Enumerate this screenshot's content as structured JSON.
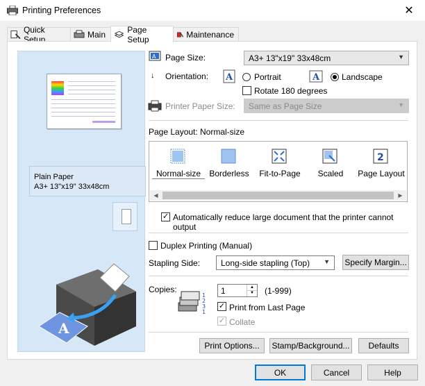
{
  "window": {
    "title": "Printing Preferences",
    "close_glyph": "✕"
  },
  "tabs": [
    {
      "label": "Quick Setup",
      "icon": "quick-setup-icon"
    },
    {
      "label": "Main",
      "icon": "main-icon"
    },
    {
      "label": "Page Setup",
      "icon": "page-setup-icon"
    },
    {
      "label": "Maintenance",
      "icon": "maintenance-icon"
    }
  ],
  "preview": {
    "media_type": "Plain Paper",
    "media_size": "A3+ 13\"x19\" 33x48cm"
  },
  "page_size": {
    "label": "Page Size:",
    "value": "A3+ 13\"x19\" 33x48cm"
  },
  "orientation": {
    "label": "Orientation:",
    "portrait": "Portrait",
    "landscape": "Landscape",
    "selected": "Landscape",
    "rotate_label": "Rotate 180 degrees",
    "rotate_checked": false
  },
  "printer_paper_size": {
    "label": "Printer Paper Size:",
    "value": "Same as Page Size"
  },
  "page_layout": {
    "label": "Page Layout:",
    "current": "Normal-size",
    "options": [
      "Normal-size",
      "Borderless",
      "Fit-to-Page",
      "Scaled",
      "Page Layout"
    ]
  },
  "auto_reduce": {
    "label": "Automatically reduce large document that the printer cannot output",
    "checked": true
  },
  "duplex": {
    "label": "Duplex Printing (Manual)",
    "checked": false
  },
  "stapling": {
    "label": "Stapling Side:",
    "value": "Long-side stapling (Top)",
    "specify_margin": "Specify Margin..."
  },
  "copies": {
    "label": "Copies:",
    "value": "1",
    "range": "(1-999)",
    "from_last_label": "Print from Last Page",
    "from_last_checked": true,
    "collate_label": "Collate",
    "collate_checked": true
  },
  "panel_buttons": {
    "print_options": "Print Options...",
    "stamp": "Stamp/Background...",
    "defaults": "Defaults"
  },
  "dialog_buttons": {
    "ok": "OK",
    "cancel": "Cancel",
    "help": "Help"
  },
  "check_glyph": "✓"
}
